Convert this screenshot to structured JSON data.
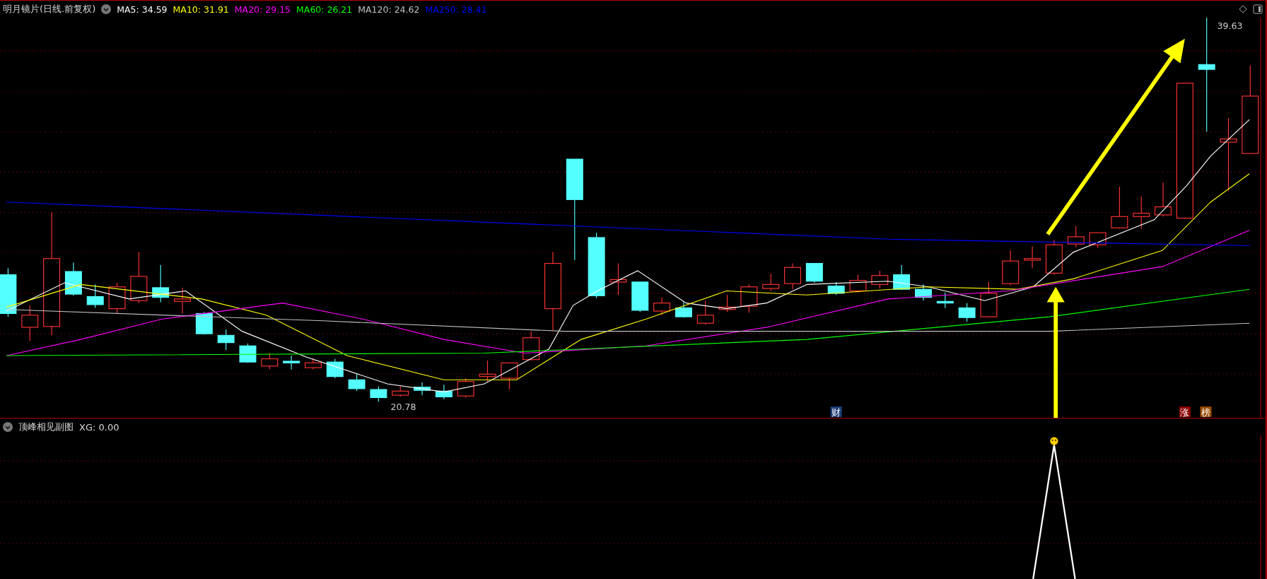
{
  "main_panel": {
    "title": "明月镜片(日线.前复权)",
    "moving_averages": [
      {
        "label": "MA5:",
        "value": "34.59",
        "color": "#ffffff"
      },
      {
        "label": "MA10:",
        "value": "31.91",
        "color": "#ffff00"
      },
      {
        "label": "MA20:",
        "value": "29.15",
        "color": "#ff00ff"
      },
      {
        "label": "MA60:",
        "value": "26.21",
        "color": "#00ff00"
      },
      {
        "label": "MA120:",
        "value": "24.62",
        "color": "#c0c0c0"
      },
      {
        "label": "MA250:",
        "value": "28.41",
        "color": "#0000ff"
      }
    ],
    "high_label": "39.63",
    "low_label": "20.78",
    "event_markers": [
      {
        "text": "财",
        "color": "#1e3f7a"
      },
      {
        "text": "涨",
        "color": "#8b0000"
      },
      {
        "text": "榜",
        "color": "#9a4a00"
      }
    ]
  },
  "sub_panel": {
    "title": "顶峰相见副图",
    "indicator": "XG:",
    "value": "0.00"
  }
}
